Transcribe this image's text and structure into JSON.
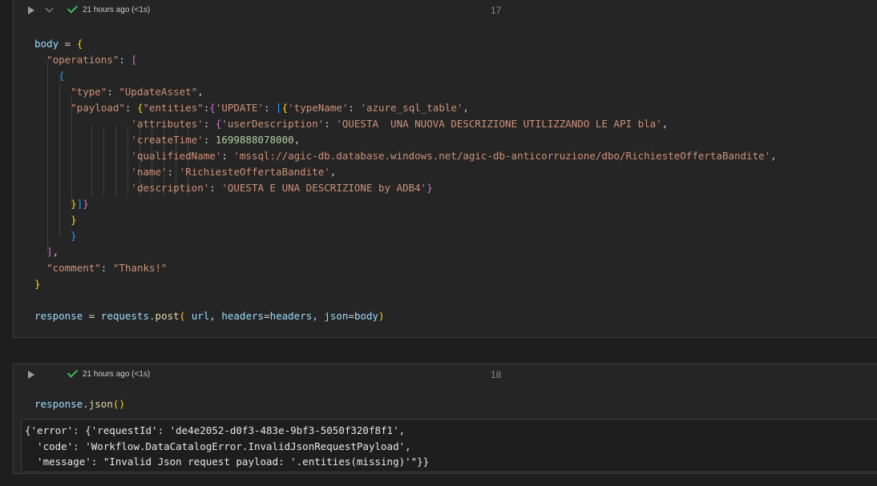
{
  "cells": [
    {
      "exec_time": "21 hours ago (<1s)",
      "exec_count": "17",
      "code": {
        "l1_var": "body",
        "l1_eq": " = ",
        "l1_brace": "{",
        "l2_key": "\"operations\"",
        "l2_colon": ": ",
        "l2_br": "[",
        "l3_br": "{",
        "l4_key": "\"type\"",
        "l4_colon": ": ",
        "l4_val": "\"UpdateAsset\"",
        "l4_comma": ",",
        "l5_key": "\"payload\"",
        "l5_colon": ": ",
        "l5_b1": "{",
        "l5_ent": "\"entities\"",
        "l5_c2": ":",
        "l5_b2": "{",
        "l5_upd": "'UPDATE'",
        "l5_c3": ": ",
        "l5_b3": "[",
        "l5_b4": "{",
        "l5_tn": "'typeName'",
        "l5_c4": ": ",
        "l5_tnv": "'azure_sql_table'",
        "l5_comma": ",",
        "l6_key": "'attributes'",
        "l6_colon": ": ",
        "l6_b": "{",
        "l6_ud": "'userDescription'",
        "l6_c2": ": ",
        "l6_val": "'QUESTA  UNA NUOVA DESCRIZIONE UTILIZZANDO LE API bla'",
        "l6_comma": ",",
        "l7_key": "'createTime'",
        "l7_colon": ": ",
        "l7_val": "1699888078000",
        "l7_comma": ",",
        "l8_key": "'qualifiedName'",
        "l8_colon": ": ",
        "l8_val": "'mssql://agic-db.database.windows.net/agic-db-anticorruzione/dbo/RichiesteOffertaBandite'",
        "l8_comma": ",",
        "l9_key": "'name'",
        "l9_colon": ": ",
        "l9_val": "'RichiesteOffertaBandite'",
        "l9_comma": ",",
        "l10_key": "'description'",
        "l10_colon": ": ",
        "l10_val": "'QUESTA E UNA DESCRIZIONE by ADB4'",
        "l10_close": "}",
        "l11_a": "}",
        "l11_b": "]",
        "l11_c": "}",
        "l12": "}",
        "l13": "}",
        "l14_br": "]",
        "l14_comma": ",",
        "l15_key": "\"comment\"",
        "l15_colon": ": ",
        "l15_val": "\"Thanks!\"",
        "l16": "}",
        "l18_var": "response",
        "l18_eq": " = ",
        "l18_obj": "requests",
        "l18_dot": ".",
        "l18_fn": "post",
        "l18_open": "(",
        "l18_a1": " url, ",
        "l18_k1": "headers",
        "l18_e1": "=",
        "l18_v1": "headers, ",
        "l18_k2": "json",
        "l18_e2": "=",
        "l18_v2": "body",
        "l18_close": ")"
      }
    },
    {
      "exec_time": "21 hours ago (<1s)",
      "exec_count": "18",
      "code": {
        "var": "response",
        "dot": ".",
        "fn": "json",
        "parens": "()"
      },
      "output": [
        "{'error': {'requestId': 'de4e2052-d0f3-483e-9bf3-5050f320f8f1',",
        "  'code': 'Workflow.DataCatalogError.InvalidJsonRequestPayload',",
        "  'message': \"Invalid Json request payload: '.entities(missing)'\"}}"
      ]
    }
  ],
  "colors": {
    "background": "#1f1f1f",
    "cell": "#252526",
    "success": "#3fb950",
    "string": "#ce9178",
    "number": "#b5cea8",
    "variable": "#9cdcfe"
  }
}
